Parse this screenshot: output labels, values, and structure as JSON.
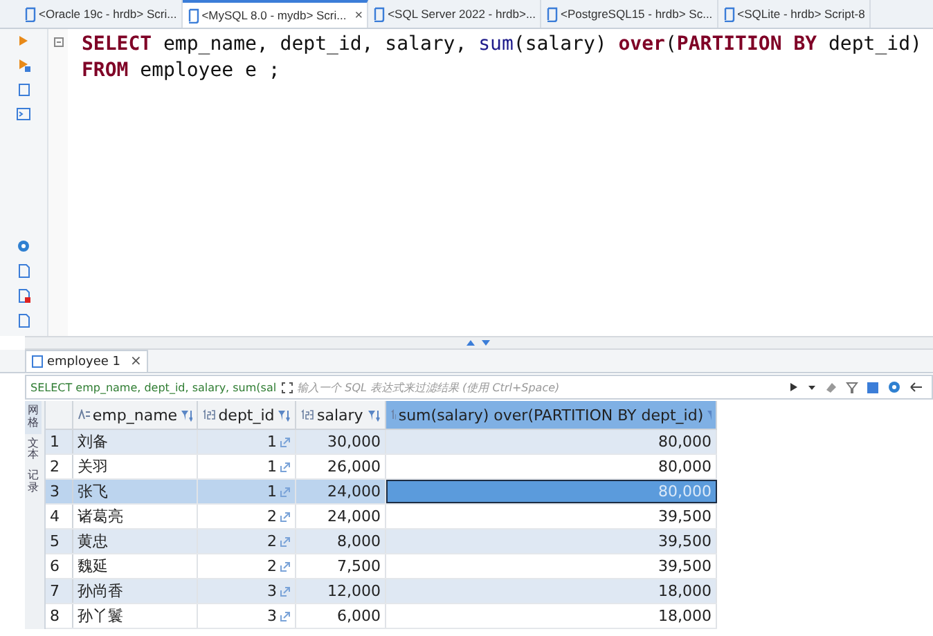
{
  "editor_tabs": [
    {
      "label": "<Oracle 19c - hrdb> Scri...",
      "selected": false
    },
    {
      "label": "<MySQL 8.0 - mydb> Scri...",
      "selected": true,
      "close": "×"
    },
    {
      "label": "<SQL Server 2022 - hrdb>...",
      "selected": false
    },
    {
      "label": "<PostgreSQL15 - hrdb> Sc...",
      "selected": false
    },
    {
      "label": "<SQLite - hrdb> Script-8",
      "selected": false
    }
  ],
  "editor": {
    "lines": [
      [
        {
          "text": "SELECT",
          "kind": "keyword"
        },
        {
          "text": " emp_name, dept_id, salary, ",
          "kind": "plain"
        },
        {
          "text": "sum",
          "kind": "function"
        },
        {
          "text": "(salary) ",
          "kind": "plain"
        },
        {
          "text": "over",
          "kind": "keyword"
        },
        {
          "text": "(",
          "kind": "plain"
        },
        {
          "text": "PARTITION BY",
          "kind": "keyword"
        },
        {
          "text": " dept_id)",
          "kind": "plain"
        }
      ],
      [
        {
          "text": "FROM",
          "kind": "keyword"
        },
        {
          "text": " employee e ;",
          "kind": "plain"
        }
      ]
    ]
  },
  "results": {
    "tab": {
      "label": "employee 1",
      "selected": true,
      "close": "×"
    },
    "filter": {
      "query": "SELECT emp_name, dept_id, salary, sum(sal",
      "placeholder": "输入一个 SQL 表达式来过滤结果 (使用 Ctrl+Space)"
    },
    "side_tabs": [
      {
        "label": "网格",
        "selected": true
      },
      {
        "label": "文本",
        "selected": false
      },
      {
        "label": "记录",
        "selected": false
      }
    ],
    "columns": [
      {
        "label": "emp_name",
        "kind": "text",
        "selected": false
      },
      {
        "label": "dept_id",
        "kind": "number",
        "selected": false
      },
      {
        "label": "salary",
        "kind": "number",
        "selected": false
      },
      {
        "label": "sum(salary) over(PARTITION BY dept_id)",
        "kind": "number",
        "selected": true
      }
    ],
    "rows": [
      {
        "num": "1",
        "cells": [
          "刘备",
          "1",
          "30,000",
          "80,000"
        ],
        "selected": false
      },
      {
        "num": "2",
        "cells": [
          "关羽",
          "1",
          "26,000",
          "80,000"
        ],
        "selected": false
      },
      {
        "num": "3",
        "cells": [
          "张飞",
          "1",
          "24,000",
          "80,000"
        ],
        "selected": true
      },
      {
        "num": "4",
        "cells": [
          "诸葛亮",
          "2",
          "24,000",
          "39,500"
        ],
        "selected": false
      },
      {
        "num": "5",
        "cells": [
          "黄忠",
          "2",
          "8,000",
          "39,500"
        ],
        "selected": false
      },
      {
        "num": "6",
        "cells": [
          "魏延",
          "2",
          "7,500",
          "39,500"
        ],
        "selected": false
      },
      {
        "num": "7",
        "cells": [
          "孙尚香",
          "3",
          "12,000",
          "18,000"
        ],
        "selected": false
      },
      {
        "num": "8",
        "cells": [
          "孙丫鬟",
          "3",
          "6,000",
          "18,000"
        ],
        "selected": false
      }
    ]
  }
}
